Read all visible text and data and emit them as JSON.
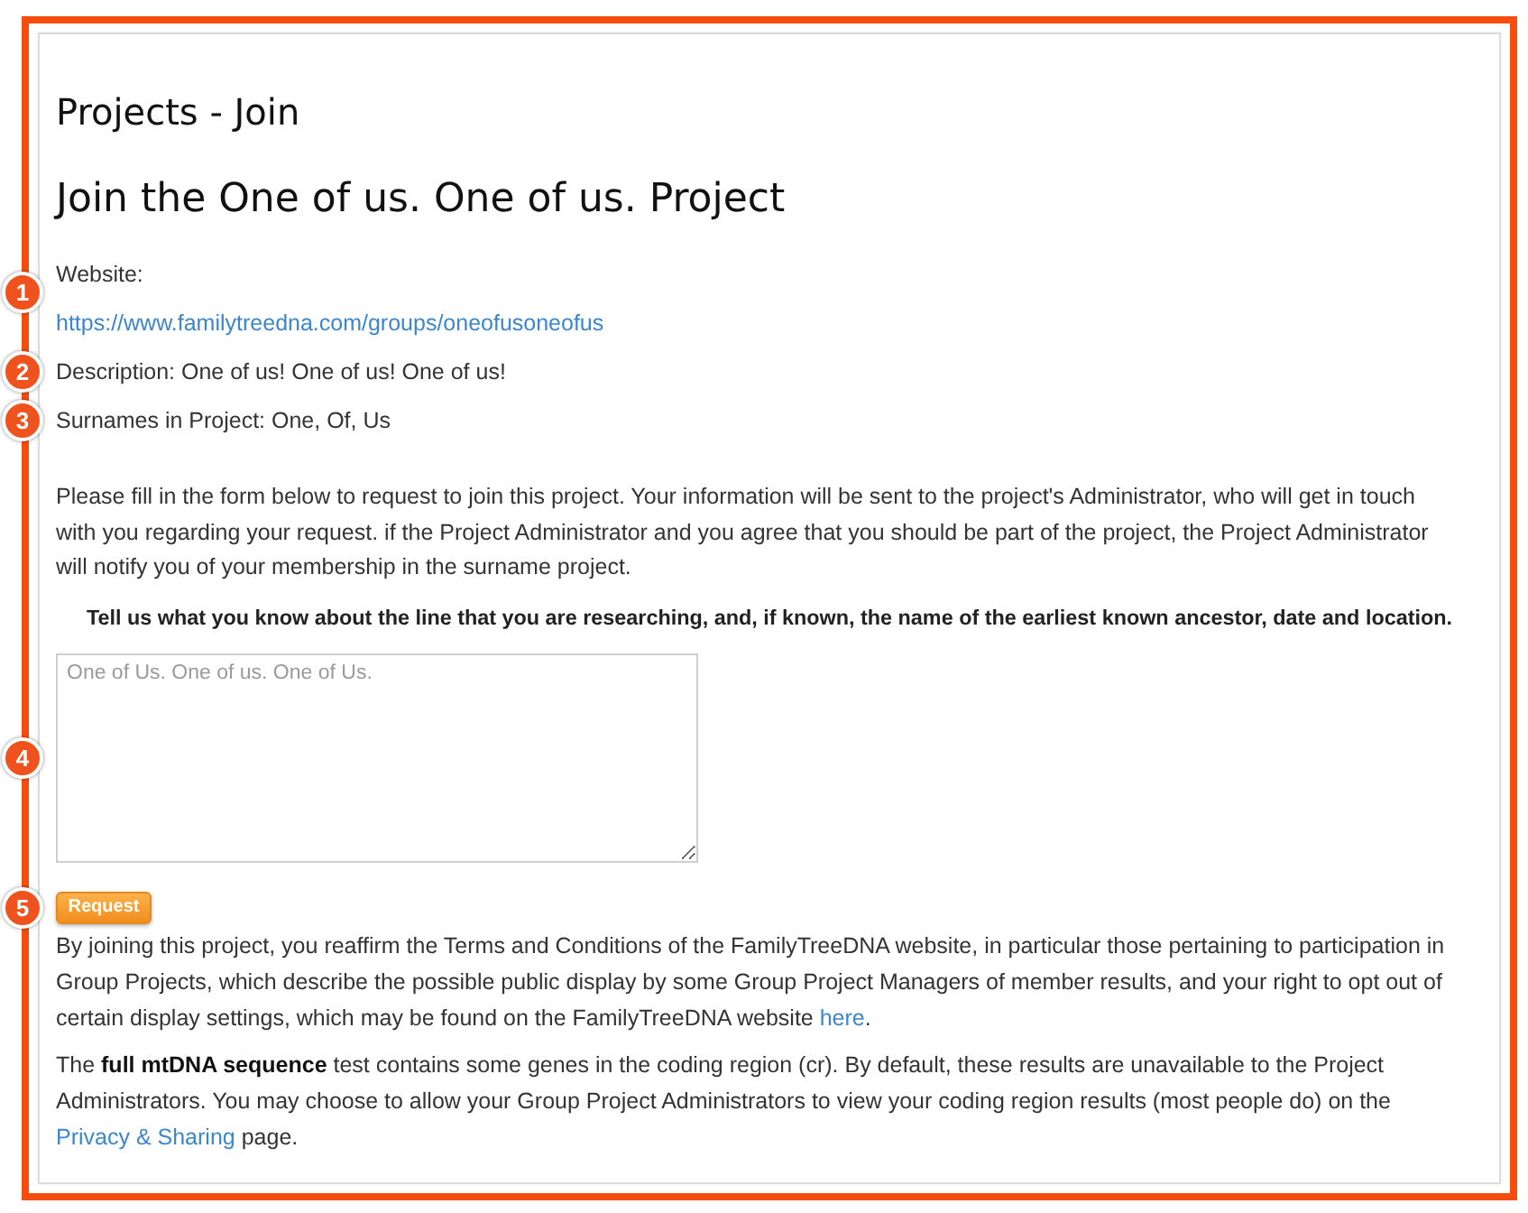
{
  "page_title": "Projects - Join",
  "heading": "Join the One of us. One of us. Project",
  "website": {
    "label": "Website:",
    "url": "https://www.familytreedna.com/groups/oneofusoneofus",
    "marker": "1"
  },
  "description": {
    "text": "Description: One of us! One of us! One of us!",
    "marker": "2"
  },
  "surnames": {
    "text": "Surnames in Project: One, Of, Us",
    "marker": "3"
  },
  "intro": "Please fill in the form below to request to join this project. Your information will be sent to the project's Administrator, who will get in touch with you regarding your request. if the Project Administrator and you agree that you should be part of the project, the Project Administrator will notify you of your membership in the surname project.",
  "prompt": "Tell us what you know about the line that you are researching, and, if known, the name of the earliest known ancestor, date and location.",
  "answer_box": {
    "placeholder": "One of Us. One of us. One of Us.",
    "marker": "4"
  },
  "request_button": {
    "label": "Request",
    "marker": "5"
  },
  "notes": [
    {
      "parts": [
        {
          "kind": "text",
          "text": "By joining this project, you reaffirm the Terms and Conditions of the FamilyTreeDNA website, in particular those pertaining to participation in Group Projects, which describe the possible public display by some Group Project Managers of member results, and your right to opt out of certain display settings, which may be found on the FamilyTreeDNA website "
        },
        {
          "kind": "link",
          "text": "here"
        },
        {
          "kind": "text",
          "text": "."
        }
      ]
    },
    {
      "parts": [
        {
          "kind": "text",
          "text": "The **full mtDNA sequence** test contains some genes in the coding region (cr). By default, these results are unavailable to the Project Administrators. You may choose to allow your Group Project Administrators to view your coding region results (most people do) on the "
        },
        {
          "kind": "link",
          "text": "Privacy & Sharing"
        },
        {
          "kind": "text",
          "text": " page."
        }
      ]
    }
  ]
}
